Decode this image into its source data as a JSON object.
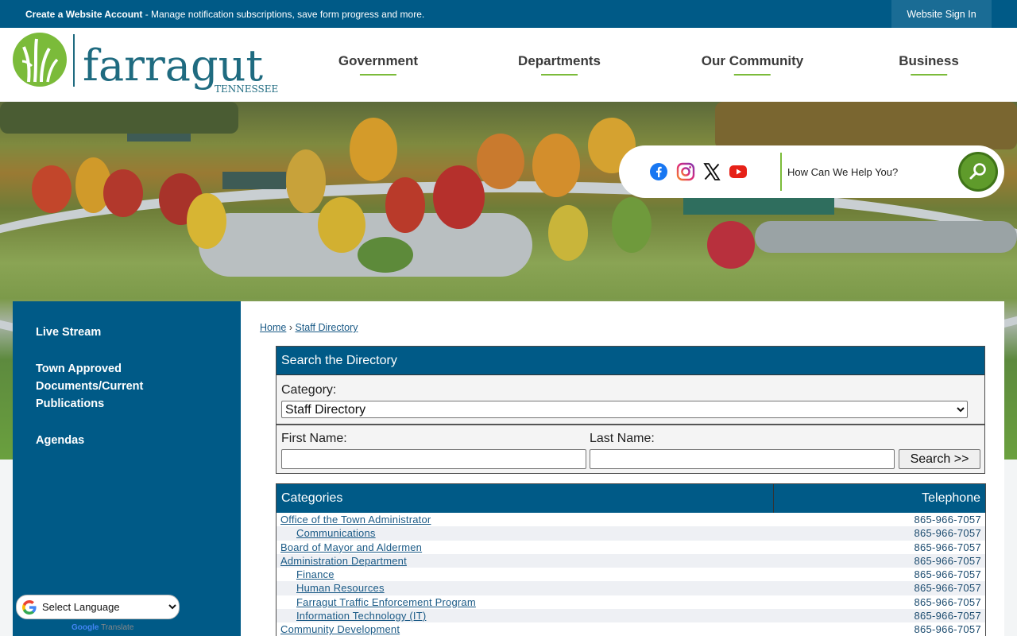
{
  "topbar": {
    "account_strong": "Create a Website Account",
    "account_text": " - Manage notification subscriptions, save form progress and more.",
    "signin_label": "Website Sign In"
  },
  "logo": {
    "name": "farragut",
    "state": "TENNESSEE"
  },
  "nav": {
    "items": [
      {
        "label": "Government"
      },
      {
        "label": "Departments"
      },
      {
        "label": "Our Community"
      },
      {
        "label": "Business"
      }
    ]
  },
  "social": {
    "facebook": "facebook-icon",
    "instagram": "instagram-icon",
    "x": "x-icon",
    "youtube": "youtube-icon"
  },
  "site_search": {
    "placeholder": "How Can We Help You?"
  },
  "sidebar": {
    "items": [
      {
        "label": "Live Stream"
      },
      {
        "label": "Town Approved Documents/Current Publications"
      },
      {
        "label": "Agendas"
      }
    ]
  },
  "translate": {
    "select_label": "Select Language",
    "powered_by": "Google",
    "powered_suffix": "Translate"
  },
  "breadcrumb": {
    "home": "Home",
    "separator": "›",
    "current": "Staff Directory"
  },
  "search_directory": {
    "heading": "Search the Directory",
    "category_label": "Category:",
    "category_value": "Staff Directory",
    "first_name_label": "First Name:",
    "last_name_label": "Last Name:",
    "search_button": "Search >>"
  },
  "directory": {
    "col_categories": "Categories",
    "col_telephone": "Telephone",
    "rows": [
      {
        "name": "Office of the Town Administrator",
        "tel": "865-966-7057",
        "sub": false
      },
      {
        "name": "Communications",
        "tel": "865-966-7057",
        "sub": true
      },
      {
        "name": "Board of Mayor and Aldermen",
        "tel": "865-966-7057",
        "sub": false
      },
      {
        "name": "Administration Department",
        "tel": "865-966-7057",
        "sub": false
      },
      {
        "name": "Finance",
        "tel": "865-966-7057",
        "sub": true
      },
      {
        "name": "Human Resources",
        "tel": "865-966-7057",
        "sub": true
      },
      {
        "name": "Farragut Traffic Enforcement Program",
        "tel": "865-966-7057",
        "sub": true
      },
      {
        "name": "Information Technology (IT)",
        "tel": "865-966-7057",
        "sub": true
      },
      {
        "name": "Community Development",
        "tel": "865-966-7057",
        "sub": false
      }
    ]
  },
  "colors": {
    "brand_blue": "#005a87",
    "accent_green": "#7bbb3a",
    "logo_teal": "#1f6b80"
  }
}
